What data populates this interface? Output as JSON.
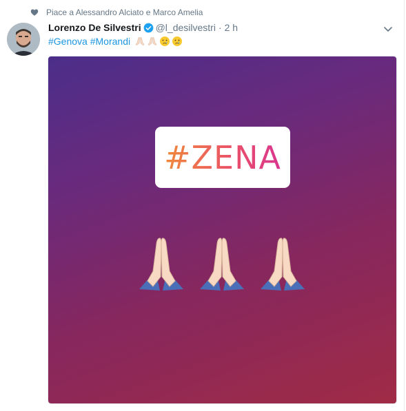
{
  "context": {
    "text": "Piace a Alessandro Alciato e Marco Amelia",
    "icon": "heart-icon"
  },
  "author": {
    "fullname": "Lorenzo De Silvestri",
    "verified": true,
    "username": "@l_desilvestri",
    "separator": "·",
    "time": "2 h"
  },
  "tweet": {
    "hashtags": [
      "#Genova",
      "#Morandi"
    ],
    "emojis": [
      "folded-hands-icon",
      "folded-hands-icon",
      "crying-face-icon",
      "crying-face-icon"
    ]
  },
  "media": {
    "tag_text": "#ZENA",
    "emojis": [
      "folded-hands-icon",
      "folded-hands-icon",
      "folded-hands-icon"
    ],
    "colors": {
      "gradient_start": "#4b2e8a",
      "gradient_end": "#a02b45",
      "tag_orange": "#f08a3a",
      "tag_pink": "#d9358f"
    }
  },
  "colors": {
    "link": "#1b95e0",
    "muted": "#657786",
    "text": "#14171a",
    "verified": "#1da1f2"
  }
}
